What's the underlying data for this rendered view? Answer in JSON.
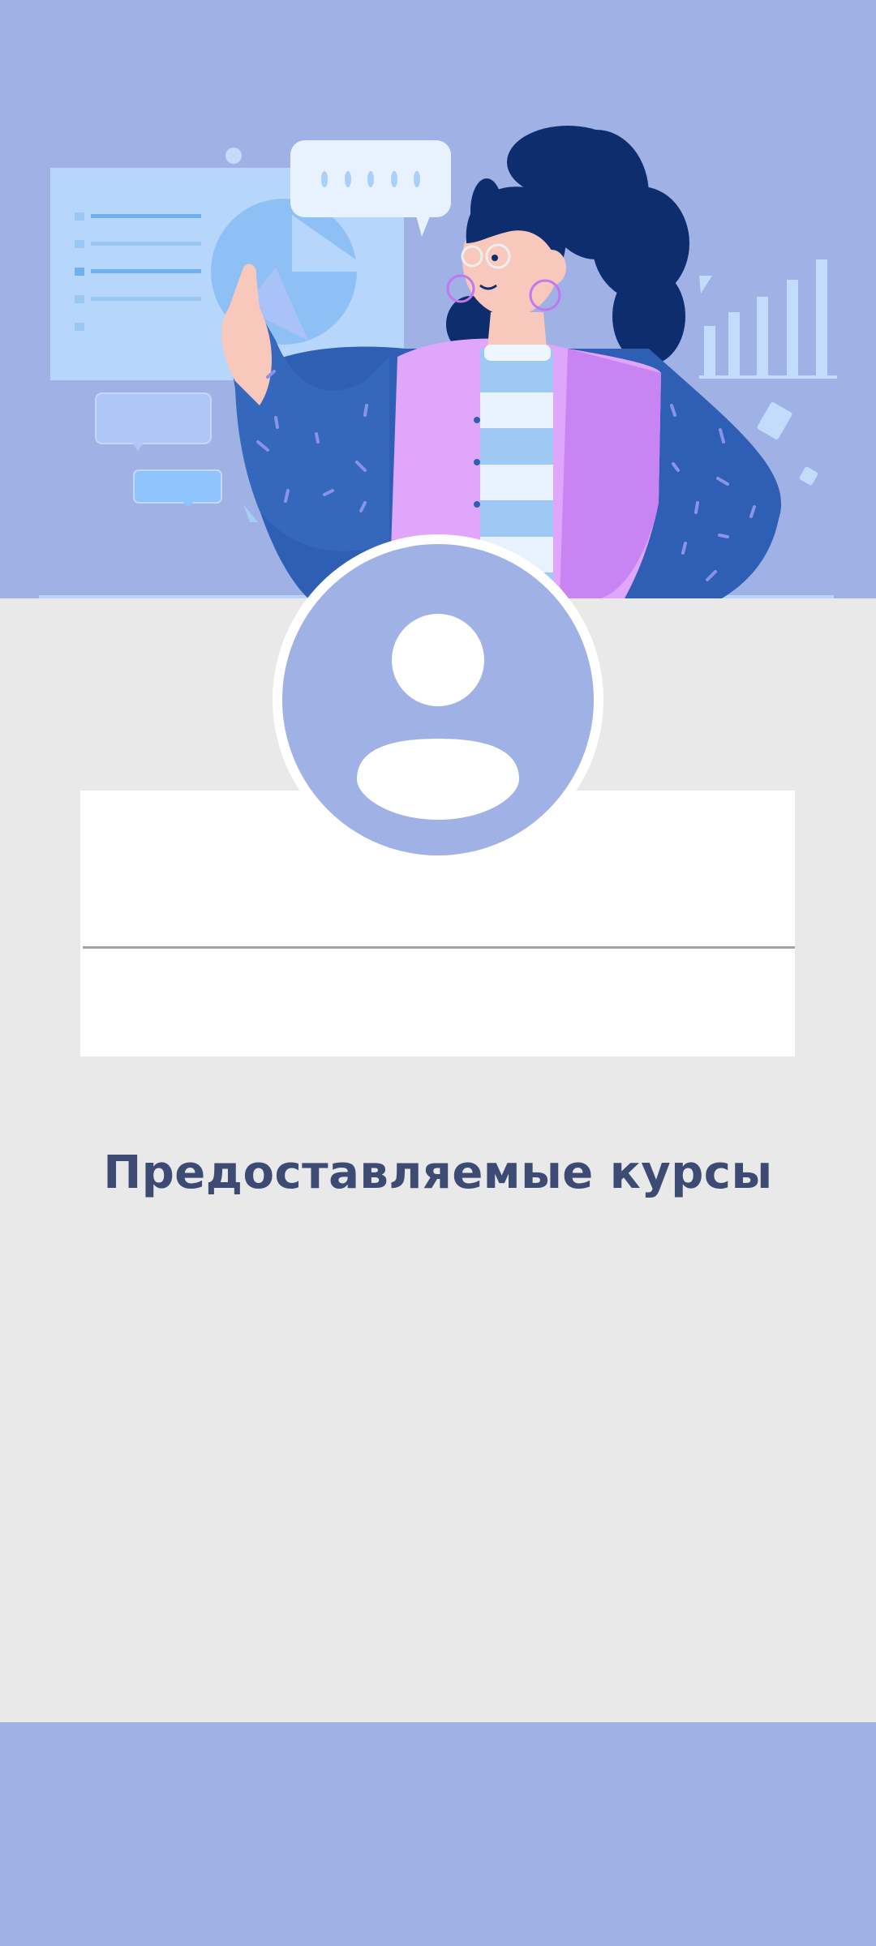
{
  "header": {
    "illustration": "teacher-illustration",
    "background_color": "#a0b1e6"
  },
  "profile": {
    "avatar_icon": "user-avatar-icon",
    "name": "",
    "subtitle": ""
  },
  "courses": {
    "title": "Предоставляемые курсы",
    "items": []
  },
  "colors": {
    "accent": "#a0b1e6",
    "title_text": "#3d4b74",
    "page_background": "#e9e9e9",
    "card_background": "#ffffff"
  }
}
